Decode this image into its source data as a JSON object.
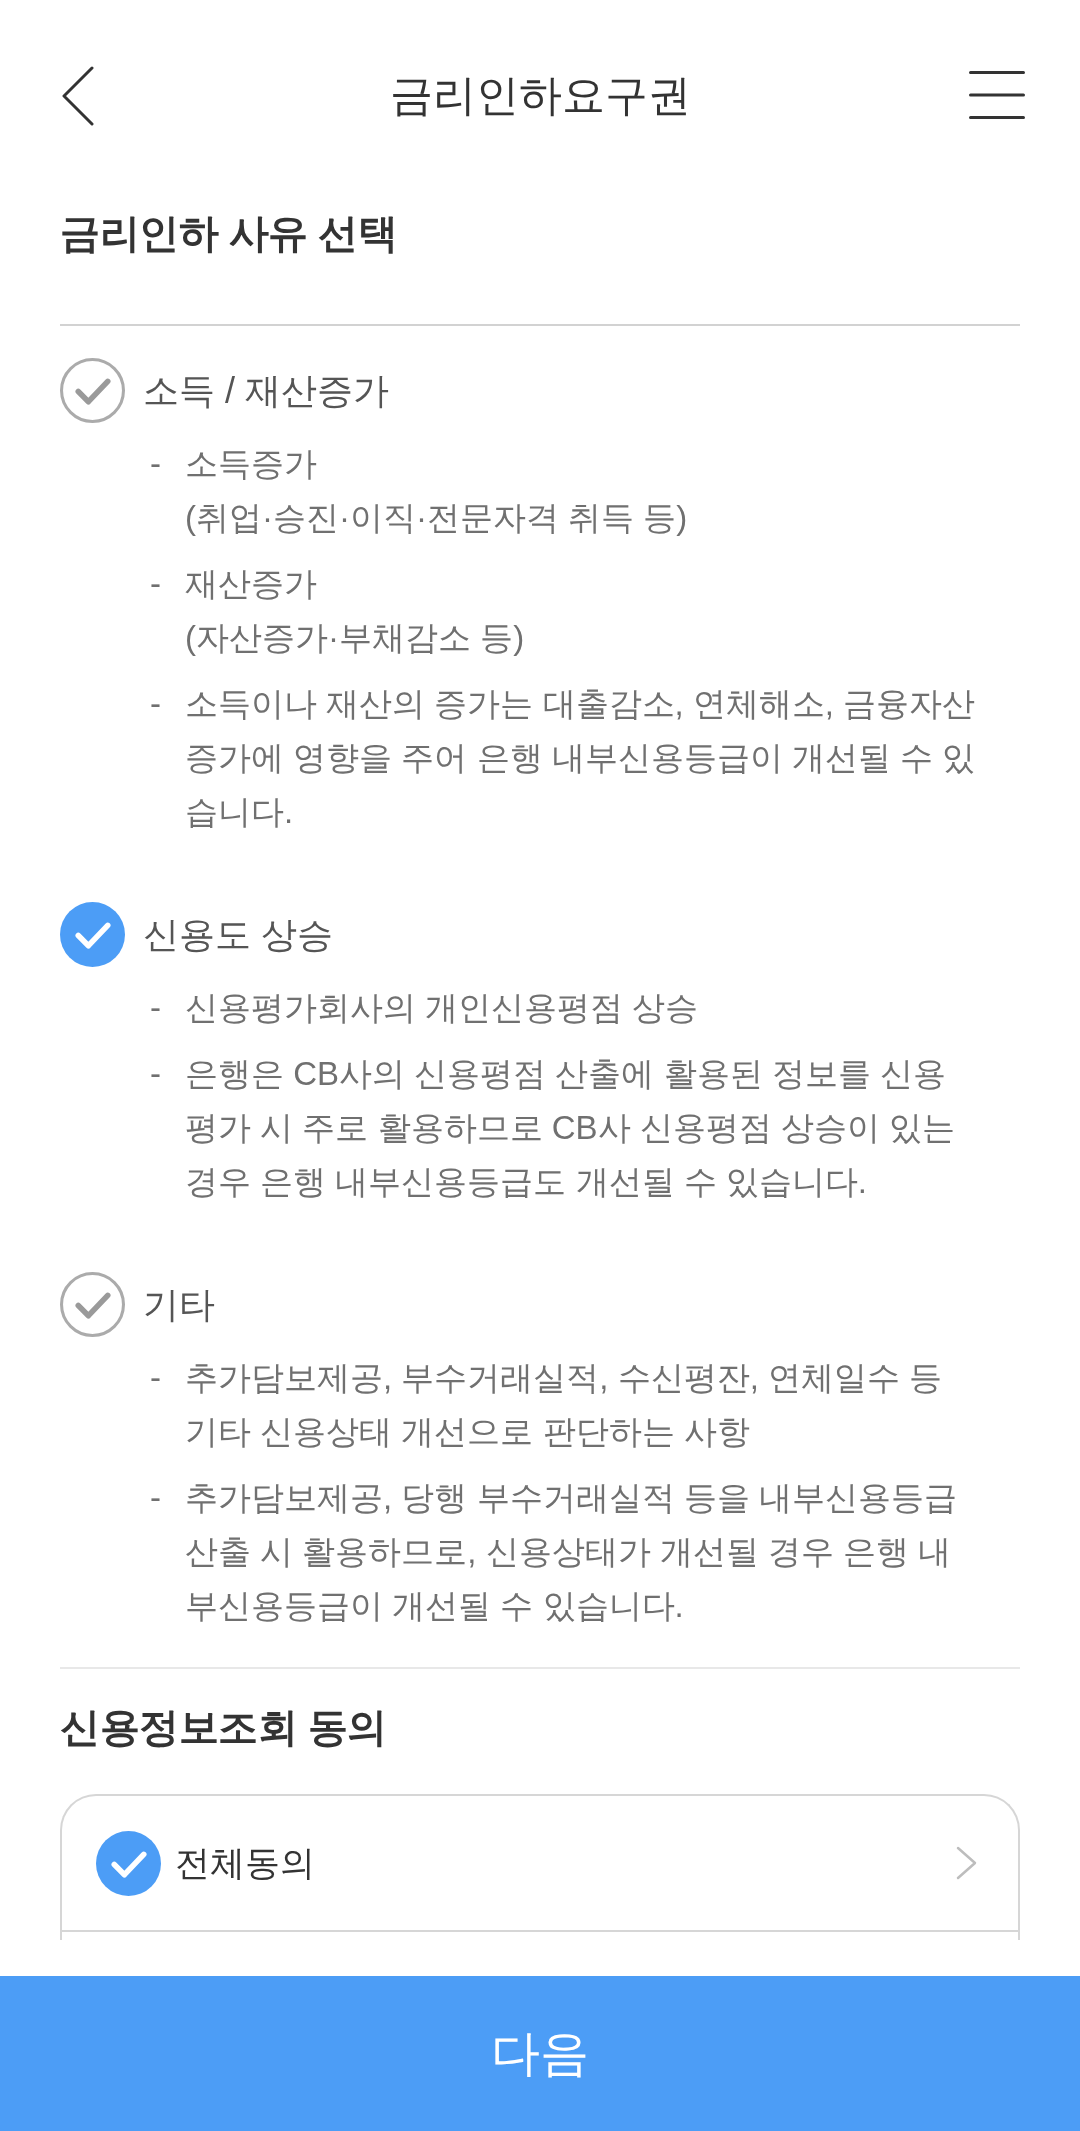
{
  "header": {
    "title": "금리인하요구권"
  },
  "reason_section": {
    "title": "금리인하 사유 선택",
    "options": [
      {
        "label": "소득 / 재산증가",
        "checked": false,
        "details": [
          {
            "marker": "-",
            "text": "소득증가\n(취업·승진·이직·전문자격 취득 등)"
          },
          {
            "marker": "-",
            "text": "재산증가\n(자산증가·부채감소 등)"
          },
          {
            "marker": "-",
            "text": "소득이나 재산의 증가는 대출감소, 연체해소, 금융자산 증가에 영향을 주어 은행 내부신용등급이 개선될 수 있습니다."
          }
        ]
      },
      {
        "label": "신용도 상승",
        "checked": true,
        "details": [
          {
            "marker": "-",
            "text": "신용평가회사의 개인신용평점 상승"
          },
          {
            "marker": "-",
            "text": "은행은 CB사의 신용평점 산출에 활용된 정보를 신용평가 시 주로 활용하므로 CB사 신용평점 상승이 있는 경우 은행 내부신용등급도 개선될 수 있습니다."
          }
        ]
      },
      {
        "label": "기타",
        "checked": false,
        "details": [
          {
            "marker": "-",
            "text": "추가담보제공, 부수거래실적, 수신평잔, 연체일수 등 기타 신용상태 개선으로 판단하는 사항"
          },
          {
            "marker": "-",
            "text": "추가담보제공, 당행 부수거래실적 등을 내부신용등급 산출 시 활용하므로, 신용상태가 개선될 경우 은행 내부신용등급이 개선될 수 있습니다."
          }
        ]
      }
    ]
  },
  "consent_section": {
    "title": "신용정보조회 동의",
    "items": [
      {
        "label": "전체동의",
        "checked": true
      }
    ]
  },
  "next_button": {
    "label": "다음"
  }
}
